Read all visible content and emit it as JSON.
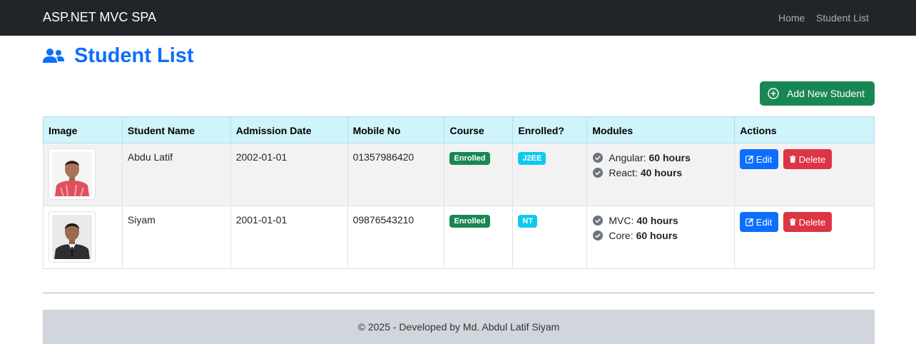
{
  "navbar": {
    "brand": "ASP.NET MVC SPA",
    "links": [
      {
        "label": "Home"
      },
      {
        "label": "Student List"
      }
    ]
  },
  "page": {
    "title": "Student List",
    "title_icon": "users-icon",
    "add_button": {
      "label": "Add New Student",
      "icon": "plus-circle-icon"
    }
  },
  "table": {
    "headers": [
      "Image",
      "Student Name",
      "Admission Date",
      "Mobile No",
      "Course",
      "Enrolled?",
      "Modules",
      "Actions"
    ],
    "rows": [
      {
        "name": "Abdu Latif",
        "admission_date": "2002-01-01",
        "mobile": "01357986420",
        "course_badge": "Enrolled",
        "enrolled_badge": "J2EE",
        "modules": [
          {
            "name": "Angular:",
            "hours": "60 hours"
          },
          {
            "name": "React:",
            "hours": "40 hours"
          }
        ]
      },
      {
        "name": "Siyam",
        "admission_date": "2001-01-01",
        "mobile": "09876543210",
        "course_badge": "Enrolled",
        "enrolled_badge": "NT",
        "modules": [
          {
            "name": "MVC:",
            "hours": "40 hours"
          },
          {
            "name": "Core:",
            "hours": "60 hours"
          }
        ]
      }
    ],
    "actions": {
      "edit_label": "Edit",
      "delete_label": "Delete"
    }
  },
  "footer": {
    "text": "© 2025 - Developed by Md. Abdul Latif Siyam"
  },
  "colors": {
    "navbar": "#212529",
    "primary": "#0d6efd",
    "success": "#198754",
    "info": "#0dcaf0",
    "danger": "#dc3545",
    "table_header": "#cff4fc"
  }
}
